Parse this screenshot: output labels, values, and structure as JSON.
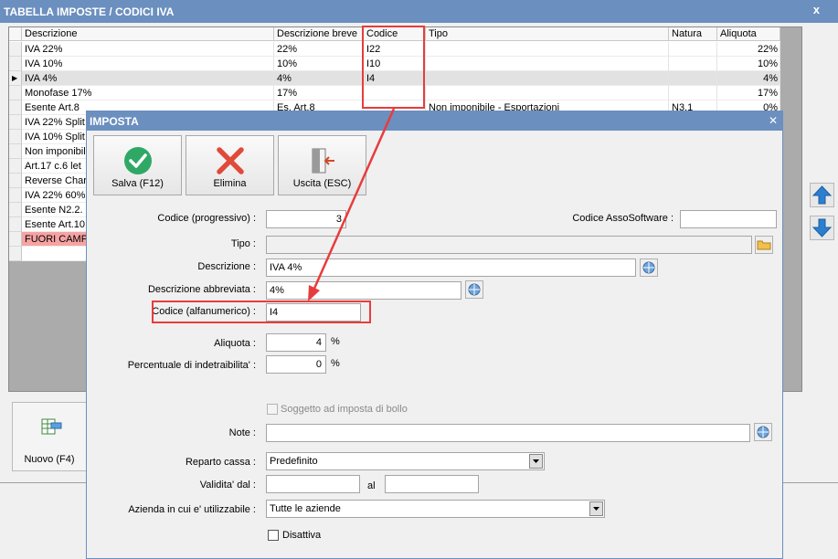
{
  "main": {
    "title": "TABELLA IMPOSTE / CODICI IVA",
    "close": "x",
    "columns": [
      "Descrizione",
      "Descrizione breve",
      "Codice",
      "Tipo",
      "Natura",
      "Aliquota"
    ],
    "rows": [
      {
        "descrizione": "IVA 22%",
        "breve": "22%",
        "codice": "I22",
        "tipo": "",
        "natura": "",
        "aliquota": "22%"
      },
      {
        "descrizione": "IVA 10%",
        "breve": "10%",
        "codice": "I10",
        "tipo": "",
        "natura": "",
        "aliquota": "10%"
      },
      {
        "descrizione": "IVA 4%",
        "breve": "4%",
        "codice": "I4",
        "tipo": "",
        "natura": "",
        "aliquota": "4%"
      },
      {
        "descrizione": "Monofase 17%",
        "breve": "17%",
        "codice": "",
        "tipo": "",
        "natura": "",
        "aliquota": "17%"
      },
      {
        "descrizione": "Esente Art.8",
        "breve": "Es. Art.8",
        "codice": "",
        "tipo": "Non imponibile - Esportazioni",
        "natura": "N3.1",
        "aliquota": "0%"
      },
      {
        "descrizione": "IVA 22% Split",
        "breve": "",
        "codice": "",
        "tipo": "",
        "natura": "",
        "aliquota": ""
      },
      {
        "descrizione": "IVA 10% Split",
        "breve": "",
        "codice": "",
        "tipo": "",
        "natura": "",
        "aliquota": ""
      },
      {
        "descrizione": "Non imponibili",
        "breve": "",
        "codice": "",
        "tipo": "",
        "natura": "",
        "aliquota": ""
      },
      {
        "descrizione": "Art.17 c.6 let",
        "breve": "",
        "codice": "",
        "tipo": "",
        "natura": "",
        "aliquota": ""
      },
      {
        "descrizione": "Reverse Charg",
        "breve": "",
        "codice": "",
        "tipo": "",
        "natura": "",
        "aliquota": ""
      },
      {
        "descrizione": "IVA 22% 60%",
        "breve": "",
        "codice": "",
        "tipo": "",
        "natura": "",
        "aliquota": ""
      },
      {
        "descrizione": "Esente N2.2.",
        "breve": "",
        "codice": "",
        "tipo": "",
        "natura": "",
        "aliquota": ""
      },
      {
        "descrizione": "Esente Art.10",
        "breve": "",
        "codice": "",
        "tipo": "",
        "natura": "",
        "aliquota": ""
      },
      {
        "descrizione": "FUORI CAMPO",
        "breve": "",
        "codice": "",
        "tipo": "",
        "natura": "",
        "aliquota": ""
      },
      {
        "descrizione": "",
        "breve": "",
        "codice": "",
        "tipo": "",
        "natura": "",
        "aliquota": ""
      }
    ],
    "new_button": "Nuovo (F4)"
  },
  "dialog": {
    "title": "IMPOSTA",
    "close": "✕",
    "toolbar": {
      "save": "Salva (F12)",
      "delete": "Elimina",
      "exit": "Uscita (ESC)"
    },
    "labels": {
      "codice_progressivo": "Codice (progressivo) :",
      "codice_assosoftware": "Codice AssoSoftware :",
      "tipo": "Tipo :",
      "descrizione": "Descrizione :",
      "descrizione_abbreviata": "Descrizione abbreviata :",
      "codice_alfanumerico": "Codice (alfanumerico) :",
      "aliquota": "Aliquota :",
      "percentuale": "Percentuale di indetraibilita' :",
      "soggetto_bollo": "Soggetto ad imposta di bollo",
      "note": "Note :",
      "reparto_cassa": "Reparto cassa :",
      "validita": "Validita' dal :",
      "al": "al",
      "azienda": "Azienda in cui e' utilizzabile :",
      "disattiva": "Disattiva"
    },
    "values": {
      "codice_progressivo": "3",
      "codice_assosoftware": "",
      "tipo": "",
      "descrizione": "IVA 4%",
      "descrizione_abbreviata": "4%",
      "codice_alfanumerico": "I4",
      "aliquota": "4",
      "percentuale": "0",
      "note": "",
      "reparto_cassa": "Predefinito",
      "validita_dal": "",
      "validita_al": "",
      "azienda": "Tutte le aziende"
    },
    "units": {
      "percent": "%"
    }
  },
  "colors": {
    "title_bar": "#6b8fbf",
    "highlight": "#e83c3c",
    "red_row": "#f7a3a3"
  }
}
